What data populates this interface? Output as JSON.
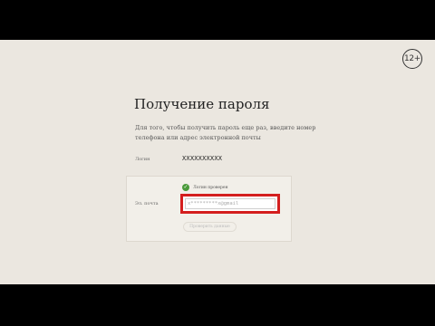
{
  "badge": {
    "age": "12+"
  },
  "form": {
    "title": "Получение пароля",
    "description": "Для того, чтобы получить пароль еще раз, введите номер телефона или адрес электронной почты",
    "login_label": "Логин",
    "login_value": "XXXXXXXXXX",
    "check_text": "Логин проверен",
    "email_label": "Эл. почта",
    "email_value": "x*********x@gmail",
    "verify_button": "Проверить данные"
  },
  "colors": {
    "background": "#ebe7e0",
    "highlight": "#d41e1e",
    "success": "#4a9a3a"
  },
  "icons": [
    "check-icon"
  ]
}
